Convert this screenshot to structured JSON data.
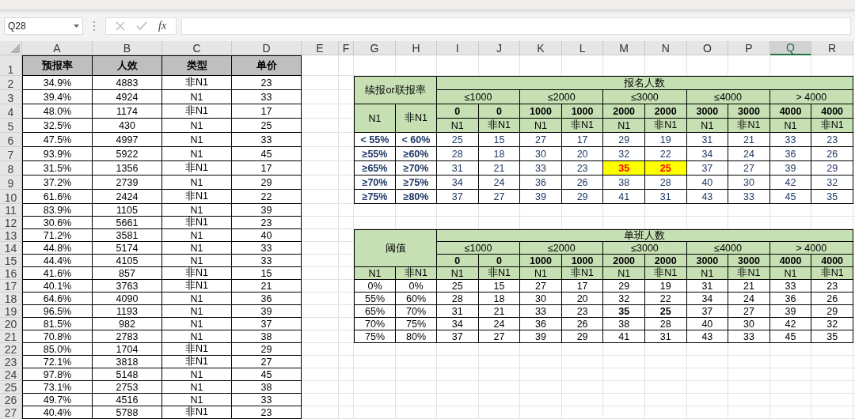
{
  "name_box": {
    "value": "Q28"
  },
  "formula_bar": {
    "function_label": "fx"
  },
  "columns": [
    {
      "label": "A",
      "selected": false
    },
    {
      "label": "B",
      "selected": false
    },
    {
      "label": "C",
      "selected": false
    },
    {
      "label": "D",
      "selected": false
    },
    {
      "label": "E",
      "selected": false
    },
    {
      "label": "F",
      "selected": false
    },
    {
      "label": "G",
      "selected": false
    },
    {
      "label": "H",
      "selected": false
    },
    {
      "label": "I",
      "selected": false
    },
    {
      "label": "J",
      "selected": false
    },
    {
      "label": "K",
      "selected": false
    },
    {
      "label": "L",
      "selected": false
    },
    {
      "label": "M",
      "selected": false
    },
    {
      "label": "N",
      "selected": false
    },
    {
      "label": "O",
      "selected": false
    },
    {
      "label": "P",
      "selected": false
    },
    {
      "label": "Q",
      "selected": true
    },
    {
      "label": "R",
      "selected": false
    }
  ],
  "row_numbers": [
    "1",
    "2",
    "3",
    "4",
    "5",
    "6",
    "7",
    "8",
    "9",
    "10",
    "11",
    "12",
    "13",
    "14",
    "15",
    "16",
    "17",
    "18",
    "19",
    "20",
    "21",
    "22",
    "23",
    "24",
    "25",
    "26",
    "27"
  ],
  "data_table": {
    "columns": [
      "预报率",
      "人效",
      "类型",
      "单价"
    ],
    "rows": [
      [
        "34.9%",
        "4883",
        "非N1",
        "23"
      ],
      [
        "39.4%",
        "4924",
        "N1",
        "33"
      ],
      [
        "48.0%",
        "1174",
        "非N1",
        "17"
      ],
      [
        "32.5%",
        "430",
        "N1",
        "25"
      ],
      [
        "47.5%",
        "4997",
        "N1",
        "33"
      ],
      [
        "93.9%",
        "5922",
        "N1",
        "45"
      ],
      [
        "31.5%",
        "1356",
        "非N1",
        "17"
      ],
      [
        "37.2%",
        "2739",
        "N1",
        "29"
      ],
      [
        "61.6%",
        "2424",
        "非N1",
        "22"
      ],
      [
        "83.9%",
        "1105",
        "N1",
        "39"
      ],
      [
        "30.6%",
        "5661",
        "非N1",
        "23"
      ],
      [
        "71.2%",
        "3581",
        "N1",
        "40"
      ],
      [
        "44.8%",
        "5174",
        "N1",
        "33"
      ],
      [
        "44.4%",
        "4105",
        "N1",
        "33"
      ],
      [
        "41.6%",
        "857",
        "非N1",
        "15"
      ],
      [
        "40.1%",
        "3763",
        "非N1",
        "21"
      ],
      [
        "64.6%",
        "4090",
        "N1",
        "36"
      ],
      [
        "96.5%",
        "1193",
        "N1",
        "39"
      ],
      [
        "81.5%",
        "982",
        "N1",
        "37"
      ],
      [
        "70.8%",
        "2783",
        "N1",
        "38"
      ],
      [
        "85.0%",
        "1704",
        "非N1",
        "29"
      ],
      [
        "72.1%",
        "3818",
        "非N1",
        "27"
      ],
      [
        "97.8%",
        "5148",
        "N1",
        "45"
      ],
      [
        "73.1%",
        "2753",
        "N1",
        "38"
      ],
      [
        "49.7%",
        "4516",
        "N1",
        "33"
      ],
      [
        "40.4%",
        "5788",
        "非N1",
        "23"
      ]
    ]
  },
  "rate_table": {
    "corner": "续报or联报率",
    "title": "报名人数",
    "ranges": [
      "≤1000",
      "≤2000",
      "≤3000",
      "≤4000",
      "> 4000"
    ],
    "thresholds": [
      "0",
      "0",
      "1000",
      "1000",
      "2000",
      "2000",
      "3000",
      "3000",
      "4000",
      "4000"
    ],
    "types": [
      "N1",
      "非N1",
      "N1",
      "非N1",
      "N1",
      "非N1",
      "N1",
      "非N1",
      "N1",
      "非N1"
    ],
    "key_types": [
      "N1",
      "非N1"
    ],
    "rows": [
      {
        "labels": [
          "< 55%",
          "< 60%"
        ],
        "cells": [
          {
            "value": "25",
            "highlighted": false
          },
          {
            "value": "15",
            "highlighted": false
          },
          {
            "value": "27",
            "highlighted": false
          },
          {
            "value": "17",
            "highlighted": false
          },
          {
            "value": "29",
            "highlighted": false
          },
          {
            "value": "19",
            "highlighted": false
          },
          {
            "value": "31",
            "highlighted": false
          },
          {
            "value": "21",
            "highlighted": false
          },
          {
            "value": "33",
            "highlighted": false
          },
          {
            "value": "23",
            "highlighted": false
          }
        ]
      },
      {
        "labels": [
          "≥55%",
          "≥60%"
        ],
        "cells": [
          {
            "value": "28",
            "highlighted": false
          },
          {
            "value": "18",
            "highlighted": false
          },
          {
            "value": "30",
            "highlighted": false
          },
          {
            "value": "20",
            "highlighted": false
          },
          {
            "value": "32",
            "highlighted": false
          },
          {
            "value": "22",
            "highlighted": false
          },
          {
            "value": "34",
            "highlighted": false
          },
          {
            "value": "24",
            "highlighted": false
          },
          {
            "value": "36",
            "highlighted": false
          },
          {
            "value": "26",
            "highlighted": false
          }
        ]
      },
      {
        "labels": [
          "≥65%",
          "≥70%"
        ],
        "cells": [
          {
            "value": "31",
            "highlighted": false
          },
          {
            "value": "21",
            "highlighted": false
          },
          {
            "value": "33",
            "highlighted": false
          },
          {
            "value": "23",
            "highlighted": false
          },
          {
            "value": "35",
            "highlighted": true
          },
          {
            "value": "25",
            "highlighted": true
          },
          {
            "value": "37",
            "highlighted": false
          },
          {
            "value": "27",
            "highlighted": false
          },
          {
            "value": "39",
            "highlighted": false
          },
          {
            "value": "29",
            "highlighted": false
          }
        ]
      },
      {
        "labels": [
          "≥70%",
          "≥75%"
        ],
        "cells": [
          {
            "value": "34",
            "highlighted": false
          },
          {
            "value": "24",
            "highlighted": false
          },
          {
            "value": "36",
            "highlighted": false
          },
          {
            "value": "26",
            "highlighted": false
          },
          {
            "value": "38",
            "highlighted": false
          },
          {
            "value": "28",
            "highlighted": false
          },
          {
            "value": "40",
            "highlighted": false
          },
          {
            "value": "30",
            "highlighted": false
          },
          {
            "value": "42",
            "highlighted": false
          },
          {
            "value": "32",
            "highlighted": false
          }
        ]
      },
      {
        "labels": [
          "≥75%",
          "≥80%"
        ],
        "cells": [
          {
            "value": "37",
            "highlighted": false
          },
          {
            "value": "27",
            "highlighted": false
          },
          {
            "value": "39",
            "highlighted": false
          },
          {
            "value": "29",
            "highlighted": false
          },
          {
            "value": "41",
            "highlighted": false
          },
          {
            "value": "31",
            "highlighted": false
          },
          {
            "value": "43",
            "highlighted": false
          },
          {
            "value": "33",
            "highlighted": false
          },
          {
            "value": "45",
            "highlighted": false
          },
          {
            "value": "35",
            "highlighted": false
          }
        ]
      }
    ]
  },
  "threshold_table": {
    "corner": "阈值",
    "title": "单班人数",
    "ranges": [
      "≤1000",
      "≤2000",
      "≤3000",
      "≤4000",
      "> 4000"
    ],
    "thresholds": [
      "0",
      "0",
      "1000",
      "1000",
      "2000",
      "2000",
      "3000",
      "3000",
      "4000",
      "4000"
    ],
    "key_types": [
      "N1",
      "非N1"
    ],
    "types": [
      "N1",
      "非N1",
      "N1",
      "非N1",
      "N1",
      "非N1",
      "N1",
      "非N1",
      "N1",
      "非N1"
    ],
    "rows": [
      {
        "labels": [
          "0%",
          "0%"
        ],
        "cells": [
          {
            "value": "25",
            "bold": false
          },
          {
            "value": "15",
            "bold": false
          },
          {
            "value": "27",
            "bold": false
          },
          {
            "value": "17",
            "bold": false
          },
          {
            "value": "29",
            "bold": false
          },
          {
            "value": "19",
            "bold": false
          },
          {
            "value": "31",
            "bold": false
          },
          {
            "value": "21",
            "bold": false
          },
          {
            "value": "33",
            "bold": false
          },
          {
            "value": "23",
            "bold": false
          }
        ]
      },
      {
        "labels": [
          "55%",
          "60%"
        ],
        "cells": [
          {
            "value": "28",
            "bold": false
          },
          {
            "value": "18",
            "bold": false
          },
          {
            "value": "30",
            "bold": false
          },
          {
            "value": "20",
            "bold": false
          },
          {
            "value": "32",
            "bold": false
          },
          {
            "value": "22",
            "bold": false
          },
          {
            "value": "34",
            "bold": false
          },
          {
            "value": "24",
            "bold": false
          },
          {
            "value": "36",
            "bold": false
          },
          {
            "value": "26",
            "bold": false
          }
        ]
      },
      {
        "labels": [
          "65%",
          "70%"
        ],
        "cells": [
          {
            "value": "31",
            "bold": false
          },
          {
            "value": "21",
            "bold": false
          },
          {
            "value": "33",
            "bold": false
          },
          {
            "value": "23",
            "bold": false
          },
          {
            "value": "35",
            "bold": true
          },
          {
            "value": "25",
            "bold": true
          },
          {
            "value": "37",
            "bold": false
          },
          {
            "value": "27",
            "bold": false
          },
          {
            "value": "39",
            "bold": false
          },
          {
            "value": "29",
            "bold": false
          }
        ]
      },
      {
        "labels": [
          "70%",
          "75%"
        ],
        "cells": [
          {
            "value": "34",
            "bold": false
          },
          {
            "value": "24",
            "bold": false
          },
          {
            "value": "36",
            "bold": false
          },
          {
            "value": "26",
            "bold": false
          },
          {
            "value": "38",
            "bold": false
          },
          {
            "value": "28",
            "bold": false
          },
          {
            "value": "40",
            "bold": false
          },
          {
            "value": "30",
            "bold": false
          },
          {
            "value": "42",
            "bold": false
          },
          {
            "value": "32",
            "bold": false
          }
        ]
      },
      {
        "labels": [
          "75%",
          "80%"
        ],
        "cells": [
          {
            "value": "37",
            "bold": false
          },
          {
            "value": "27",
            "bold": false
          },
          {
            "value": "39",
            "bold": false
          },
          {
            "value": "29",
            "bold": false
          },
          {
            "value": "41",
            "bold": false
          },
          {
            "value": "31",
            "bold": false
          },
          {
            "value": "43",
            "bold": false
          },
          {
            "value": "33",
            "bold": false
          },
          {
            "value": "45",
            "bold": false
          },
          {
            "value": "35",
            "bold": false
          }
        ]
      }
    ]
  }
}
